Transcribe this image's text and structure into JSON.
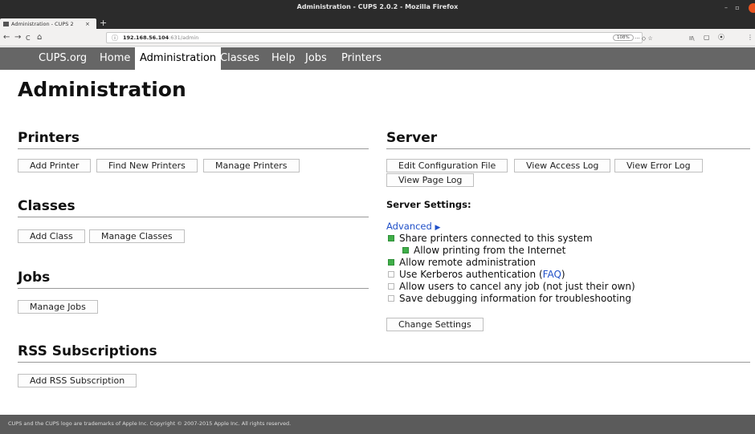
{
  "window": {
    "title": "Administration - CUPS 2.0.2 - Mozilla Firefox",
    "minimize": "–",
    "maximize": "▫",
    "close": ""
  },
  "browser": {
    "tab_label": "Administration - CUPS 2",
    "tab_close": "×",
    "new_tab": "+",
    "back": "←",
    "forward": "→",
    "reload": "C",
    "home": "⌂",
    "url_host": "192.168.56.104",
    "url_rest": ":631/admin",
    "zoom": "108%",
    "page_actions": "···  ◇  ☆",
    "library": "II\\",
    "sidebar": "▢",
    "menu": "⦿",
    "overflow": "⋮"
  },
  "nav": {
    "items": [
      {
        "label": "CUPS.org"
      },
      {
        "label": "Home"
      },
      {
        "label": "Administration"
      },
      {
        "label": "Classes"
      },
      {
        "label": "Help"
      },
      {
        "label": "Jobs"
      },
      {
        "label": "Printers"
      }
    ],
    "active": "Administration"
  },
  "page": {
    "title": "Administration"
  },
  "printers": {
    "heading": "Printers",
    "add": "Add Printer",
    "find": "Find New Printers",
    "manage": "Manage Printers"
  },
  "classes": {
    "heading": "Classes",
    "add": "Add Class",
    "manage": "Manage Classes"
  },
  "jobs": {
    "heading": "Jobs",
    "manage": "Manage Jobs"
  },
  "rss": {
    "heading": "RSS Subscriptions",
    "add": "Add RSS Subscription"
  },
  "server": {
    "heading": "Server",
    "edit_config": "Edit Configuration File",
    "view_access": "View Access Log",
    "view_error": "View Error Log",
    "view_page": "View Page Log",
    "settings_heading": "Server Settings:",
    "advanced": "Advanced",
    "advanced_arrow": "▶",
    "options": [
      {
        "label": "Share printers connected to this system",
        "checked": true
      },
      {
        "label": "Allow printing from the Internet",
        "checked": true
      },
      {
        "label": "Allow remote administration",
        "checked": true
      },
      {
        "label": "Use Kerberos authentication (",
        "link": "FAQ",
        "suffix": ")",
        "checked": false
      },
      {
        "label": "Allow users to cancel any job (not just their own)",
        "checked": false
      },
      {
        "label": "Save debugging information for troubleshooting",
        "checked": false
      }
    ],
    "change_settings": "Change Settings"
  },
  "footer": {
    "text": "CUPS and the CUPS logo are trademarks of Apple Inc. Copyright © 2007-2015 Apple Inc. All rights reserved."
  },
  "colors": {
    "nav_bg": "#666666",
    "footer_bg": "#5b5b5b",
    "checkbox_on": "#3fae49",
    "link": "#2050c8"
  }
}
